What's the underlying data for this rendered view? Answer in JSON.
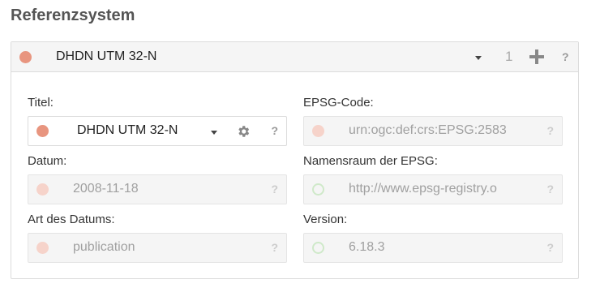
{
  "section": {
    "title": "Referenzsystem"
  },
  "header": {
    "value": "DHDN UTM 32-N",
    "count": "1",
    "help": "?"
  },
  "fields": {
    "titel": {
      "label": "Titel:",
      "value": "DHDN UTM 32-N",
      "help": "?"
    },
    "epsg_code": {
      "label": "EPSG-Code:",
      "value": "urn:ogc:def:crs:EPSG:2583",
      "help": "?"
    },
    "datum": {
      "label": "Datum:",
      "value": "2008-11-18",
      "help": "?"
    },
    "namensraum": {
      "label": "Namensraum der EPSG:",
      "value": "http://www.epsg-registry.o",
      "help": "?"
    },
    "art_des_datums": {
      "label": "Art des Datums:",
      "value": "publication",
      "help": "?"
    },
    "version": {
      "label": "Version:",
      "value": "6.18.3",
      "help": "?"
    }
  },
  "colors": {
    "status_main": "#e8957f",
    "status_faded": "#f6d3ca",
    "status_ok": "#cfe9c9"
  },
  "icons": {
    "add": "plus-icon",
    "settings": "gear-icon",
    "dropdown": "chevron-down-icon",
    "help": "help-icon"
  }
}
